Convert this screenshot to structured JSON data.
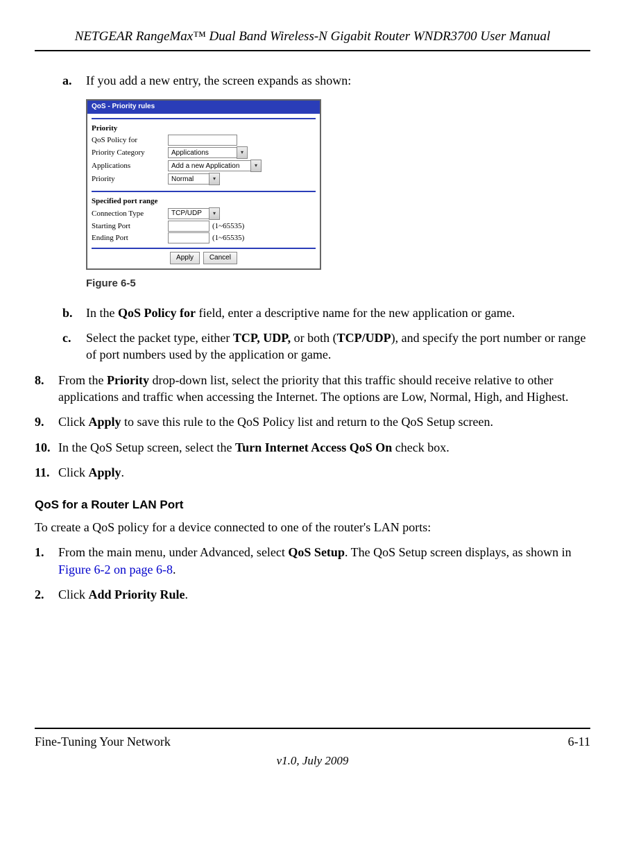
{
  "header": {
    "title": "NETGEAR RangeMax™ Dual Band Wireless-N Gigabit Router WNDR3700 User Manual"
  },
  "sub_steps": {
    "a": {
      "marker": "a.",
      "text": "If you add a new entry, the screen expands as shown:"
    },
    "b": {
      "marker": "b.",
      "prefix": "In the ",
      "bold1": "QoS Policy for",
      "suffix": " field, enter a descriptive name for the new application or game."
    },
    "c": {
      "marker": "c.",
      "prefix": "Select the packet type, either ",
      "bold1": "TCP, UDP,",
      "mid": " or both (",
      "bold2": "TCP/UDP",
      "suffix": "), and specify the port number or range of port numbers used by the application or game."
    }
  },
  "main_steps": {
    "s8": {
      "marker": "8.",
      "prefix": "From the ",
      "bold1": "Priority",
      "suffix": " drop-down list, select the priority that this traffic should receive relative to other applications and traffic when accessing the Internet. The options are Low, Normal, High, and Highest."
    },
    "s9": {
      "marker": "9.",
      "prefix": "Click ",
      "bold1": "Apply",
      "suffix": " to save this rule to the QoS Policy list and return to the QoS Setup screen."
    },
    "s10": {
      "marker": "10.",
      "prefix": "In the QoS Setup screen, select the ",
      "bold1": "Turn Internet Access QoS On",
      "suffix": " check box."
    },
    "s11": {
      "marker": "11.",
      "prefix": "Click ",
      "bold1": "Apply",
      "suffix": "."
    }
  },
  "figure": {
    "caption": "Figure 6-5",
    "titlebar": "QoS - Priority rules",
    "section1": "Priority",
    "rows": {
      "r1_label": "QoS Policy for",
      "r2_label": "Priority Category",
      "r2_value": "Applications",
      "r3_label": "Applications",
      "r3_value": "Add a new Application",
      "r4_label": "Priority",
      "r4_value": "Normal"
    },
    "section2": "Specified port range",
    "rows2": {
      "r5_label": "Connection Type",
      "r5_value": "TCP/UDP",
      "r6_label": "Starting Port",
      "r6_note": "(1~65535)",
      "r7_label": "Ending Port",
      "r7_note": "(1~65535)"
    },
    "buttons": {
      "apply": "Apply",
      "cancel": "Cancel"
    }
  },
  "section_heading": "QoS for a Router LAN Port",
  "intro_p": "To create a QoS policy for a device connected to one of the router's LAN ports:",
  "steps2": {
    "s1": {
      "marker": "1.",
      "prefix": "From the main menu, under Advanced, select ",
      "bold1": "QoS Setup",
      "mid": ". The QoS Setup screen displays, as shown in ",
      "link": "Figure 6-2 on page 6-8",
      "suffix": "."
    },
    "s2": {
      "marker": "2.",
      "prefix": "Click ",
      "bold1": "Add Priority Rule",
      "suffix": "."
    }
  },
  "footer": {
    "left": "Fine-Tuning Your Network",
    "right": "6-11",
    "center": "v1.0, July 2009"
  }
}
